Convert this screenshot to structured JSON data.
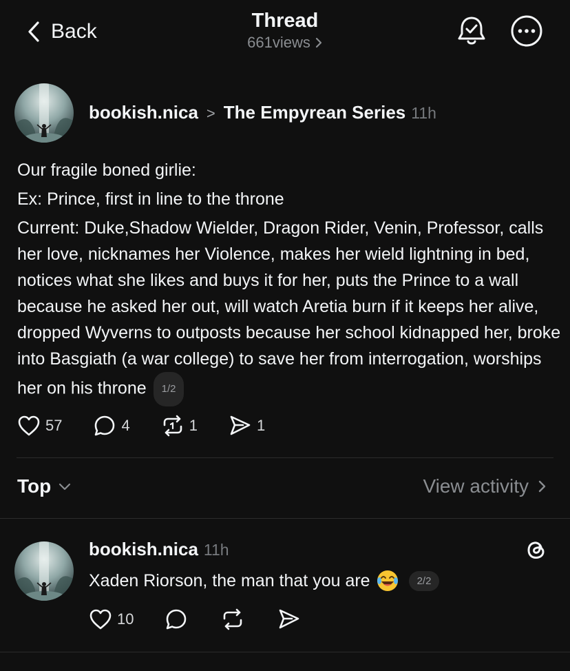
{
  "header": {
    "back_label": "Back",
    "title": "Thread",
    "views": "661views"
  },
  "post": {
    "username": "bookish.nica",
    "topic": "The Empyrean Series",
    "time": "11h",
    "lines": [
      "Our fragile boned girlie:",
      "Ex: Prince, first in line to the throne",
      "Current: Duke,Shadow Wielder, Dragon Rider, Venin, Professor, calls her love, nicknames her Violence, makes her wield lightning in bed, notices what she likes and buys it for her, puts the Prince to a wall because he asked her out, will watch Aretia burn if it keeps her alive, dropped Wyverns to outposts because her school kidnapped her, broke into Basgiath (a war college) to save her from interrogation, worships her on his throne"
    ],
    "pager": "1/2",
    "likes": "57",
    "comments": "4",
    "reposts": "1",
    "shares": "1"
  },
  "sort": {
    "label": "Top",
    "view_activity": "View activity"
  },
  "reply": {
    "username": "bookish.nica",
    "time": "11h",
    "text": "Xaden Riorson, the man that you are",
    "pager": "2/2",
    "likes": "10"
  },
  "icons": {
    "back": "chevron-left-icon",
    "bell": "bell-check-icon",
    "more": "more-icon",
    "heart": "heart-icon",
    "comment": "comment-icon",
    "repost": "repost-icon",
    "share": "send-icon",
    "threads": "threads-logo-icon",
    "emoji": "laughing-emoji-icon"
  },
  "colors": {
    "background": "#101010",
    "text": "#f3f5f7",
    "muted": "#777a7e",
    "divider": "#2c2c2c"
  }
}
